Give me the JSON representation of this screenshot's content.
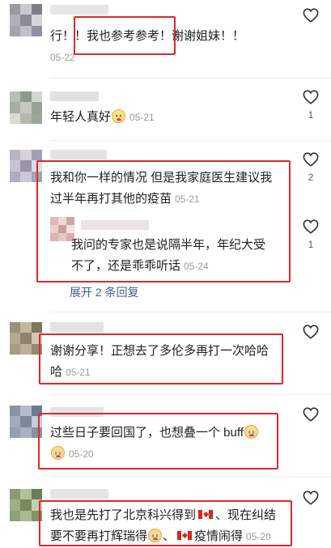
{
  "comments": [
    {
      "text": "行！！我也参考参考！谢谢姐妹！！",
      "date": "05-22",
      "likes": ""
    },
    {
      "text": "年轻人真好",
      "date": "05-21",
      "likes": "1",
      "emoji": "crying-laugh-emoji"
    },
    {
      "text_line1": "我和你一样的情况 但是我家庭医生建议我",
      "text_line2": "过半年再打其他的疫苗",
      "date": "05-21",
      "likes": "2",
      "reply": {
        "text_line1": "我问的专家也是说隔半年，年纪大受",
        "text_line2": "不了，还是乖乖听话",
        "date": "05-24",
        "likes": "1"
      },
      "expand_label": "展开 2 条回复"
    },
    {
      "text_line1": "谢谢分享！正想去了多伦多再打一次哈哈",
      "text_line2": "哈",
      "date": "05-21",
      "likes": ""
    },
    {
      "text": "过些日子要回国了，也想叠一个 buff",
      "date": "05-20",
      "likes": "",
      "emoji": "crying-emoji"
    },
    {
      "text_line1a": "我也是先打了北京科兴得到",
      "text_line1b": "、现在纠结",
      "text_line2a": "要不要再打辉瑞得",
      "text_line2b": "、",
      "text_line2c": "疫情闹得",
      "date": "05-20",
      "likes": "",
      "flag": "canada-flag-emoji"
    }
  ],
  "colors": {
    "highlight": "#e02828",
    "date": "#9a9a9a",
    "link": "#3e5f8c"
  }
}
